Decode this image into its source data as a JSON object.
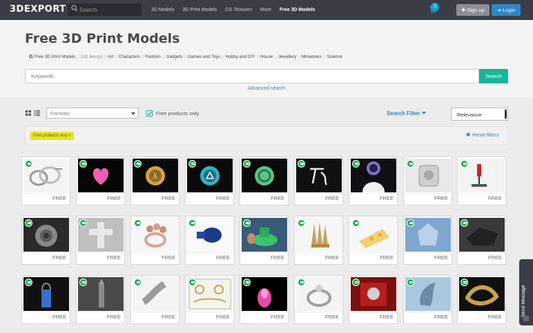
{
  "brand": "3DEXPORT",
  "search": {
    "placeholder": "Search"
  },
  "nav": [
    "3D Models",
    "3D Print Models",
    "CG Textures",
    "More",
    "Free 3D Models"
  ],
  "cart_count": "0",
  "signup_label": "Sign up",
  "login_label": "Login",
  "title": "Free 3D Print Models",
  "breadcrumb": {
    "root": "Free 3D Print Models",
    "count": "131 item(s)",
    "categories": [
      "Art",
      "Characters",
      "Fashion",
      "Gadgets",
      "Games and Toys",
      "Hobby and DIY",
      "House",
      "Jewellery",
      "Miniatures",
      "Science"
    ]
  },
  "keywords": {
    "placeholder": "Keywords",
    "button": "Search"
  },
  "advanced_search": "Advanced search",
  "filters": {
    "formats_placeholder": "Formats",
    "free_only_label": "Free products only",
    "search_filter_label": "Search Filter",
    "sort_value": "Relevance",
    "active_tag": "Free products only ×",
    "reset_label": "Reset filters"
  },
  "colors": {
    "accent_green": "#1bb39a",
    "link_blue": "#2f86c8",
    "badge_green": "#1bb34a",
    "topbar": "#3b3d46"
  },
  "products": [
    {
      "price": "FREE",
      "thumb": "rings"
    },
    {
      "price": "FREE",
      "thumb": "heart"
    },
    {
      "price": "FREE",
      "thumb": "half-life-medal"
    },
    {
      "price": "FREE",
      "thumb": "playstation-medal"
    },
    {
      "price": "FREE",
      "thumb": "green-arrows-medal"
    },
    {
      "price": "FREE",
      "thumb": "white-symbol"
    },
    {
      "price": "FREE",
      "thumb": "moon-pendant"
    },
    {
      "price": "FREE",
      "thumb": "tube-part"
    },
    {
      "price": "FREE",
      "thumb": "red-tool"
    },
    {
      "price": "FREE",
      "thumb": "gear-ring"
    },
    {
      "price": "FREE",
      "thumb": "cross-pendant"
    },
    {
      "price": "FREE",
      "thumb": "flower-ring"
    },
    {
      "price": "FREE",
      "thumb": "blue-part"
    },
    {
      "price": "FREE",
      "thumb": "green-boat"
    },
    {
      "price": "FREE",
      "thumb": "spikes"
    },
    {
      "price": "FREE",
      "thumb": "cheese"
    },
    {
      "price": "FREE",
      "thumb": "glass-eagle"
    },
    {
      "price": "FREE",
      "thumb": "dark-machine"
    },
    {
      "price": "FREE",
      "thumb": "blue-lock"
    },
    {
      "price": "FREE",
      "thumb": "bullet"
    },
    {
      "price": "FREE",
      "thumb": "blurred-object"
    },
    {
      "price": "FREE",
      "thumb": "ring-layout-sheet"
    },
    {
      "price": "FREE",
      "thumb": "pink-glow"
    },
    {
      "price": "FREE",
      "thumb": "silver-ring"
    },
    {
      "price": "FREE",
      "thumb": "red-box-pendant"
    },
    {
      "price": "FREE",
      "thumb": "twisted-shape"
    },
    {
      "price": "FREE",
      "thumb": "gold-knot"
    }
  ],
  "send_message": "Send Message"
}
